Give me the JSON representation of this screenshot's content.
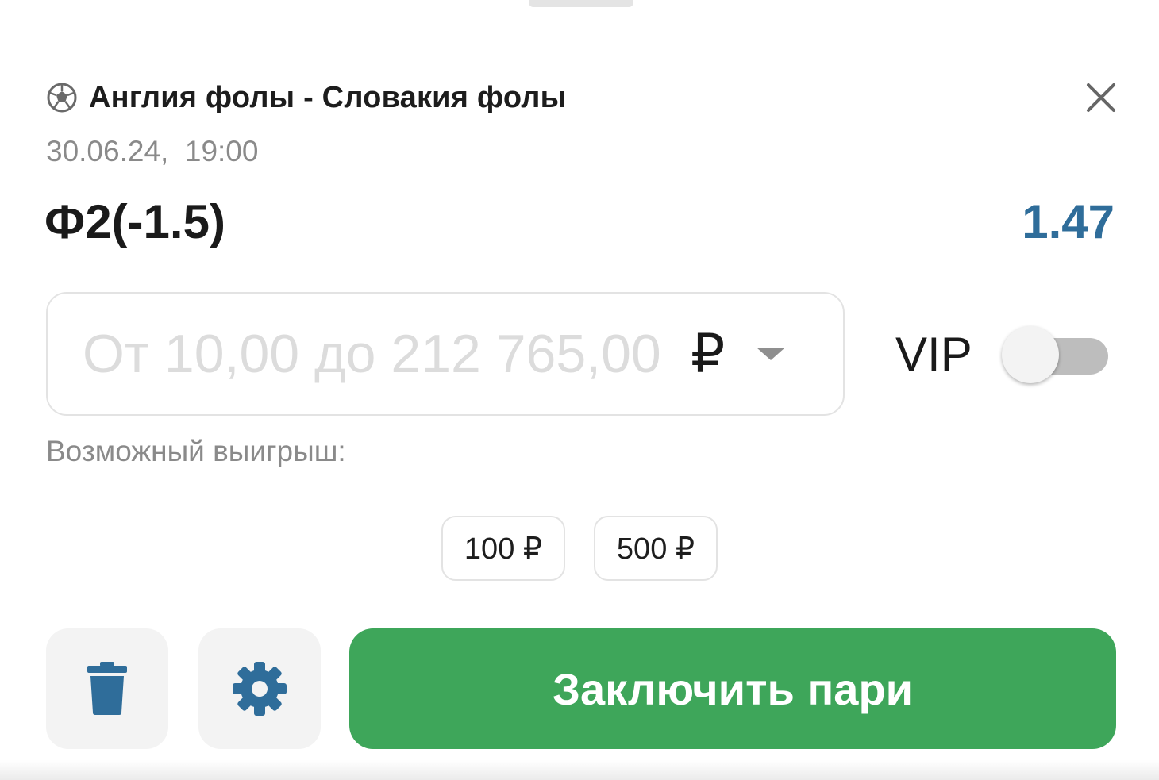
{
  "event": {
    "sport_icon": "soccer-ball-icon",
    "title": "Англия фолы - Словакия фолы",
    "datetime": "30.06.24,  19:00",
    "close_icon": "close-icon"
  },
  "bet": {
    "outcome": "Ф2(-1.5)",
    "odds": "1.47"
  },
  "stake": {
    "value": "",
    "placeholder": "От 10,00 до 212 765,00",
    "currency": "₽"
  },
  "vip": {
    "label": "VIP",
    "enabled": false
  },
  "possible_win_label": "Возможный выигрыш:",
  "quick_amounts": [
    "100 ₽",
    "500 ₽"
  ],
  "actions": {
    "delete_icon": "trash-icon",
    "settings_icon": "gear-icon",
    "submit_label": "Заключить пари"
  },
  "colors": {
    "odds": "#2f6d9a",
    "primary_button": "#3ea65a",
    "icon_accent": "#2f6d9a"
  }
}
